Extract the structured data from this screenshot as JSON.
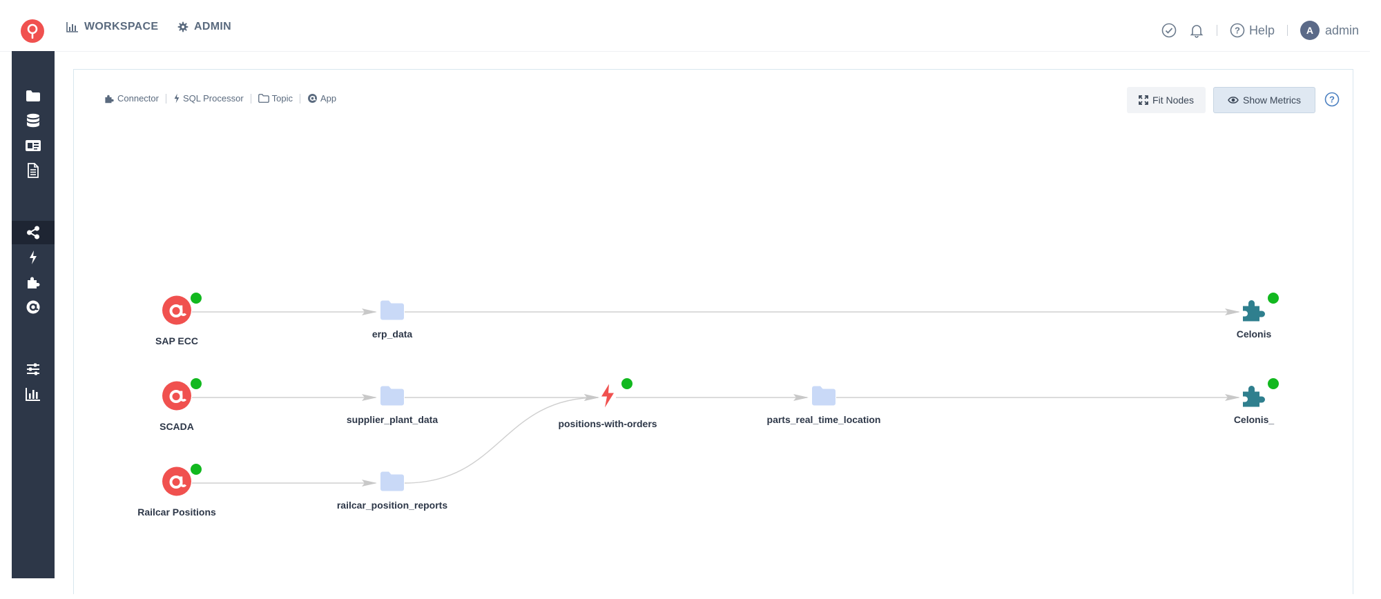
{
  "topbar": {
    "nav": [
      {
        "label": "WORKSPACE",
        "icon": "bar-chart-icon"
      },
      {
        "label": "ADMIN",
        "icon": "gear-icon"
      }
    ],
    "help_label": "Help",
    "user_initial": "A",
    "user_name": "admin"
  },
  "sidebar": {
    "items": [
      {
        "icon": "folder-icon",
        "active": false
      },
      {
        "icon": "database-icon",
        "active": false
      },
      {
        "icon": "id-card-icon",
        "active": false
      },
      {
        "icon": "document-icon",
        "active": false
      },
      {
        "icon": "share-nodes-icon",
        "active": true
      },
      {
        "icon": "bolt-icon",
        "active": false
      },
      {
        "icon": "puzzle-icon",
        "active": false
      },
      {
        "icon": "at-sign-icon",
        "active": false
      },
      {
        "icon": "sliders-icon",
        "active": false
      },
      {
        "icon": "bar-chart-icon",
        "active": false
      }
    ]
  },
  "legend": [
    {
      "label": "Connector",
      "icon": "puzzle-icon"
    },
    {
      "label": "SQL Processor",
      "icon": "bolt-icon"
    },
    {
      "label": "Topic",
      "icon": "folder-outline-icon"
    },
    {
      "label": "App",
      "icon": "at-sign-icon"
    }
  ],
  "toolbar": {
    "fit_nodes_label": "Fit Nodes",
    "show_metrics_label": "Show Metrics"
  },
  "colors": {
    "app": "#f0514f",
    "topic": "#c9d9f7",
    "processor": "#f0514f",
    "connector": "#2f7f8e",
    "status_ok": "#12b81f",
    "sidebar": "#2d3748",
    "edge": "#cfcfcf"
  },
  "nodes": [
    {
      "id": "sap-ecc",
      "label": "SAP ECC",
      "type": "app",
      "status": true
    },
    {
      "id": "scada",
      "label": "SCADA",
      "type": "app",
      "status": true
    },
    {
      "id": "railcar-positions",
      "label": "Railcar Positions",
      "type": "app",
      "status": true
    },
    {
      "id": "erp-data",
      "label": "erp_data",
      "type": "topic",
      "status": false
    },
    {
      "id": "supplier-plant-data",
      "label": "supplier_plant_data",
      "type": "topic",
      "status": false
    },
    {
      "id": "railcar-position-reports",
      "label": "railcar_position_reports",
      "type": "topic",
      "status": false
    },
    {
      "id": "positions-with-orders",
      "label": "positions-with-orders",
      "type": "processor",
      "status": true
    },
    {
      "id": "parts-real-time-location",
      "label": "parts_real_time_location",
      "type": "topic",
      "status": false
    },
    {
      "id": "celonis",
      "label": "Celonis",
      "type": "connector",
      "status": true
    },
    {
      "id": "celonis-2",
      "label": "Celonis_",
      "type": "connector",
      "status": true
    }
  ],
  "edges": [
    [
      "sap-ecc",
      "erp-data"
    ],
    [
      "erp-data",
      "celonis"
    ],
    [
      "scada",
      "supplier-plant-data"
    ],
    [
      "supplier-plant-data",
      "positions-with-orders"
    ],
    [
      "railcar-positions",
      "railcar-position-reports"
    ],
    [
      "railcar-position-reports",
      "positions-with-orders"
    ],
    [
      "positions-with-orders",
      "parts-real-time-location"
    ],
    [
      "parts-real-time-location",
      "celonis-2"
    ]
  ]
}
